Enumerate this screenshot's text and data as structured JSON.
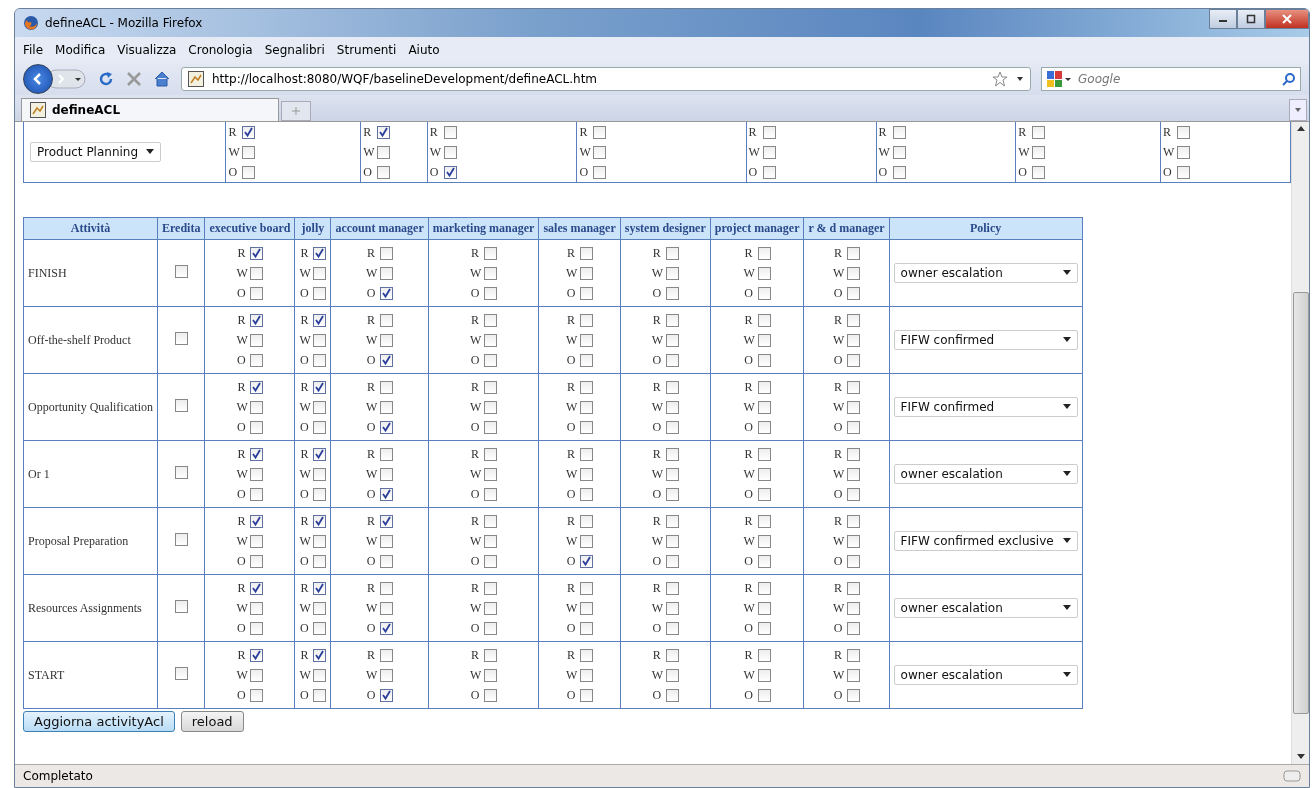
{
  "window": {
    "title": "defineACL - Mozilla Firefox"
  },
  "menu": [
    "File",
    "Modifica",
    "Visualizza",
    "Cronologia",
    "Segnalibri",
    "Strumenti",
    "Aiuto"
  ],
  "address": {
    "value": "http://localhost:8080/WQF/baselineDevelopment/defineACL.htm"
  },
  "search": {
    "placeholder": "Google"
  },
  "tabs": [
    {
      "label": "defineACL",
      "selected": true
    }
  ],
  "top_row": {
    "select": "Product Planning",
    "cells": [
      [
        {
          "letter": "R",
          "checked": true
        },
        {
          "letter": "W",
          "checked": false
        },
        {
          "letter": "O",
          "checked": false
        }
      ],
      [
        {
          "letter": "R",
          "checked": true
        },
        {
          "letter": "W",
          "checked": false
        },
        {
          "letter": "O",
          "checked": false
        }
      ],
      [
        {
          "letter": "R",
          "checked": false
        },
        {
          "letter": "W",
          "checked": false
        },
        {
          "letter": "O",
          "checked": true
        }
      ],
      [
        {
          "letter": "R",
          "checked": false
        },
        {
          "letter": "W",
          "checked": false
        },
        {
          "letter": "O",
          "checked": false
        }
      ],
      [
        {
          "letter": "R",
          "checked": false
        },
        {
          "letter": "W",
          "checked": false
        },
        {
          "letter": "O",
          "checked": false
        }
      ],
      [
        {
          "letter": "R",
          "checked": false
        },
        {
          "letter": "W",
          "checked": false
        },
        {
          "letter": "O",
          "checked": false
        }
      ],
      [
        {
          "letter": "R",
          "checked": false
        },
        {
          "letter": "W",
          "checked": false
        },
        {
          "letter": "O",
          "checked": false
        }
      ],
      [
        {
          "letter": "R",
          "checked": false
        },
        {
          "letter": "W",
          "checked": false
        },
        {
          "letter": "O",
          "checked": false
        }
      ]
    ]
  },
  "table": {
    "columns": [
      "Attività",
      "Eredita",
      "executive board",
      "jolly",
      "account manager",
      "marketing manager",
      "sales manager",
      "system designer",
      "project manager",
      "r & d manager",
      "Policy"
    ],
    "rows": [
      {
        "activity": "FINISH",
        "inherit": false,
        "executive_board": [
          {
            "letter": "R",
            "checked": true
          },
          {
            "letter": "W",
            "checked": false
          },
          {
            "letter": "O",
            "checked": false
          }
        ],
        "jolly": [
          {
            "letter": "R",
            "checked": true
          },
          {
            "letter": "W",
            "checked": false
          },
          {
            "letter": "O",
            "checked": false
          }
        ],
        "account_manager": [
          {
            "letter": "R",
            "checked": false
          },
          {
            "letter": "W",
            "checked": false
          },
          {
            "letter": "O",
            "checked": true
          }
        ],
        "marketing_manager": [
          {
            "letter": "R",
            "checked": false
          },
          {
            "letter": "W",
            "checked": false
          },
          {
            "letter": "O",
            "checked": false
          }
        ],
        "sales_manager": [
          {
            "letter": "R",
            "checked": false
          },
          {
            "letter": "W",
            "checked": false
          },
          {
            "letter": "O",
            "checked": false
          }
        ],
        "system_designer": [
          {
            "letter": "R",
            "checked": false
          },
          {
            "letter": "W",
            "checked": false
          },
          {
            "letter": "O",
            "checked": false
          }
        ],
        "project_manager": [
          {
            "letter": "R",
            "checked": false
          },
          {
            "letter": "W",
            "checked": false
          },
          {
            "letter": "O",
            "checked": false
          }
        ],
        "rd_manager": [
          {
            "letter": "R",
            "checked": false
          },
          {
            "letter": "W",
            "checked": false
          },
          {
            "letter": "O",
            "checked": false
          }
        ],
        "policy": "owner escalation"
      },
      {
        "activity": "Off-the-shelf Product",
        "inherit": false,
        "executive_board": [
          {
            "letter": "R",
            "checked": true
          },
          {
            "letter": "W",
            "checked": false
          },
          {
            "letter": "O",
            "checked": false
          }
        ],
        "jolly": [
          {
            "letter": "R",
            "checked": true
          },
          {
            "letter": "W",
            "checked": false
          },
          {
            "letter": "O",
            "checked": false
          }
        ],
        "account_manager": [
          {
            "letter": "R",
            "checked": false
          },
          {
            "letter": "W",
            "checked": false
          },
          {
            "letter": "O",
            "checked": true
          }
        ],
        "marketing_manager": [
          {
            "letter": "R",
            "checked": false
          },
          {
            "letter": "W",
            "checked": false
          },
          {
            "letter": "O",
            "checked": false
          }
        ],
        "sales_manager": [
          {
            "letter": "R",
            "checked": false
          },
          {
            "letter": "W",
            "checked": false
          },
          {
            "letter": "O",
            "checked": false
          }
        ],
        "system_designer": [
          {
            "letter": "R",
            "checked": false
          },
          {
            "letter": "W",
            "checked": false
          },
          {
            "letter": "O",
            "checked": false
          }
        ],
        "project_manager": [
          {
            "letter": "R",
            "checked": false
          },
          {
            "letter": "W",
            "checked": false
          },
          {
            "letter": "O",
            "checked": false
          }
        ],
        "rd_manager": [
          {
            "letter": "R",
            "checked": false
          },
          {
            "letter": "W",
            "checked": false
          },
          {
            "letter": "O",
            "checked": false
          }
        ],
        "policy": "FIFW confirmed"
      },
      {
        "activity": "Opportunity Qualification",
        "inherit": false,
        "executive_board": [
          {
            "letter": "R",
            "checked": true
          },
          {
            "letter": "W",
            "checked": false
          },
          {
            "letter": "O",
            "checked": false
          }
        ],
        "jolly": [
          {
            "letter": "R",
            "checked": true
          },
          {
            "letter": "W",
            "checked": false
          },
          {
            "letter": "O",
            "checked": false
          }
        ],
        "account_manager": [
          {
            "letter": "R",
            "checked": false
          },
          {
            "letter": "W",
            "checked": false
          },
          {
            "letter": "O",
            "checked": true
          }
        ],
        "marketing_manager": [
          {
            "letter": "R",
            "checked": false
          },
          {
            "letter": "W",
            "checked": false
          },
          {
            "letter": "O",
            "checked": false
          }
        ],
        "sales_manager": [
          {
            "letter": "R",
            "checked": false
          },
          {
            "letter": "W",
            "checked": false
          },
          {
            "letter": "O",
            "checked": false
          }
        ],
        "system_designer": [
          {
            "letter": "R",
            "checked": false
          },
          {
            "letter": "W",
            "checked": false
          },
          {
            "letter": "O",
            "checked": false
          }
        ],
        "project_manager": [
          {
            "letter": "R",
            "checked": false
          },
          {
            "letter": "W",
            "checked": false
          },
          {
            "letter": "O",
            "checked": false
          }
        ],
        "rd_manager": [
          {
            "letter": "R",
            "checked": false
          },
          {
            "letter": "W",
            "checked": false
          },
          {
            "letter": "O",
            "checked": false
          }
        ],
        "policy": "FIFW confirmed"
      },
      {
        "activity": "Or 1",
        "inherit": false,
        "executive_board": [
          {
            "letter": "R",
            "checked": true
          },
          {
            "letter": "W",
            "checked": false
          },
          {
            "letter": "O",
            "checked": false
          }
        ],
        "jolly": [
          {
            "letter": "R",
            "checked": true
          },
          {
            "letter": "W",
            "checked": false
          },
          {
            "letter": "O",
            "checked": false
          }
        ],
        "account_manager": [
          {
            "letter": "R",
            "checked": false
          },
          {
            "letter": "W",
            "checked": false
          },
          {
            "letter": "O",
            "checked": true
          }
        ],
        "marketing_manager": [
          {
            "letter": "R",
            "checked": false
          },
          {
            "letter": "W",
            "checked": false
          },
          {
            "letter": "O",
            "checked": false
          }
        ],
        "sales_manager": [
          {
            "letter": "R",
            "checked": false
          },
          {
            "letter": "W",
            "checked": false
          },
          {
            "letter": "O",
            "checked": false
          }
        ],
        "system_designer": [
          {
            "letter": "R",
            "checked": false
          },
          {
            "letter": "W",
            "checked": false
          },
          {
            "letter": "O",
            "checked": false
          }
        ],
        "project_manager": [
          {
            "letter": "R",
            "checked": false
          },
          {
            "letter": "W",
            "checked": false
          },
          {
            "letter": "O",
            "checked": false
          }
        ],
        "rd_manager": [
          {
            "letter": "R",
            "checked": false
          },
          {
            "letter": "W",
            "checked": false
          },
          {
            "letter": "O",
            "checked": false
          }
        ],
        "policy": "owner escalation"
      },
      {
        "activity": "Proposal Preparation",
        "inherit": false,
        "executive_board": [
          {
            "letter": "R",
            "checked": true
          },
          {
            "letter": "W",
            "checked": false
          },
          {
            "letter": "O",
            "checked": false
          }
        ],
        "jolly": [
          {
            "letter": "R",
            "checked": true
          },
          {
            "letter": "W",
            "checked": false
          },
          {
            "letter": "O",
            "checked": false
          }
        ],
        "account_manager": [
          {
            "letter": "R",
            "checked": true
          },
          {
            "letter": "W",
            "checked": false
          },
          {
            "letter": "O",
            "checked": false
          }
        ],
        "marketing_manager": [
          {
            "letter": "R",
            "checked": false
          },
          {
            "letter": "W",
            "checked": false
          },
          {
            "letter": "O",
            "checked": false
          }
        ],
        "sales_manager": [
          {
            "letter": "R",
            "checked": false
          },
          {
            "letter": "W",
            "checked": false
          },
          {
            "letter": "O",
            "checked": true
          }
        ],
        "system_designer": [
          {
            "letter": "R",
            "checked": false
          },
          {
            "letter": "W",
            "checked": false
          },
          {
            "letter": "O",
            "checked": false
          }
        ],
        "project_manager": [
          {
            "letter": "R",
            "checked": false
          },
          {
            "letter": "W",
            "checked": false
          },
          {
            "letter": "O",
            "checked": false
          }
        ],
        "rd_manager": [
          {
            "letter": "R",
            "checked": false
          },
          {
            "letter": "W",
            "checked": false
          },
          {
            "letter": "O",
            "checked": false
          }
        ],
        "policy": "FIFW confirmed exclusive"
      },
      {
        "activity": "Resources Assignments",
        "inherit": false,
        "executive_board": [
          {
            "letter": "R",
            "checked": true
          },
          {
            "letter": "W",
            "checked": false
          },
          {
            "letter": "O",
            "checked": false
          }
        ],
        "jolly": [
          {
            "letter": "R",
            "checked": true
          },
          {
            "letter": "W",
            "checked": false
          },
          {
            "letter": "O",
            "checked": false
          }
        ],
        "account_manager": [
          {
            "letter": "R",
            "checked": false
          },
          {
            "letter": "W",
            "checked": false
          },
          {
            "letter": "O",
            "checked": true
          }
        ],
        "marketing_manager": [
          {
            "letter": "R",
            "checked": false
          },
          {
            "letter": "W",
            "checked": false
          },
          {
            "letter": "O",
            "checked": false
          }
        ],
        "sales_manager": [
          {
            "letter": "R",
            "checked": false
          },
          {
            "letter": "W",
            "checked": false
          },
          {
            "letter": "O",
            "checked": false
          }
        ],
        "system_designer": [
          {
            "letter": "R",
            "checked": false
          },
          {
            "letter": "W",
            "checked": false
          },
          {
            "letter": "O",
            "checked": false
          }
        ],
        "project_manager": [
          {
            "letter": "R",
            "checked": false
          },
          {
            "letter": "W",
            "checked": false
          },
          {
            "letter": "O",
            "checked": false
          }
        ],
        "rd_manager": [
          {
            "letter": "R",
            "checked": false
          },
          {
            "letter": "W",
            "checked": false
          },
          {
            "letter": "O",
            "checked": false
          }
        ],
        "policy": "owner escalation"
      },
      {
        "activity": "START",
        "inherit": false,
        "executive_board": [
          {
            "letter": "R",
            "checked": true
          },
          {
            "letter": "W",
            "checked": false
          },
          {
            "letter": "O",
            "checked": false
          }
        ],
        "jolly": [
          {
            "letter": "R",
            "checked": true
          },
          {
            "letter": "W",
            "checked": false
          },
          {
            "letter": "O",
            "checked": false
          }
        ],
        "account_manager": [
          {
            "letter": "R",
            "checked": false
          },
          {
            "letter": "W",
            "checked": false
          },
          {
            "letter": "O",
            "checked": true
          }
        ],
        "marketing_manager": [
          {
            "letter": "R",
            "checked": false
          },
          {
            "letter": "W",
            "checked": false
          },
          {
            "letter": "O",
            "checked": false
          }
        ],
        "sales_manager": [
          {
            "letter": "R",
            "checked": false
          },
          {
            "letter": "W",
            "checked": false
          },
          {
            "letter": "O",
            "checked": false
          }
        ],
        "system_designer": [
          {
            "letter": "R",
            "checked": false
          },
          {
            "letter": "W",
            "checked": false
          },
          {
            "letter": "O",
            "checked": false
          }
        ],
        "project_manager": [
          {
            "letter": "R",
            "checked": false
          },
          {
            "letter": "W",
            "checked": false
          },
          {
            "letter": "O",
            "checked": false
          }
        ],
        "rd_manager": [
          {
            "letter": "R",
            "checked": false
          },
          {
            "letter": "W",
            "checked": false
          },
          {
            "letter": "O",
            "checked": false
          }
        ],
        "policy": "owner escalation"
      }
    ]
  },
  "buttons": [
    {
      "label": "Aggiorna activityAcl",
      "kind": "primary"
    },
    {
      "label": "reload",
      "kind": "plain"
    }
  ],
  "status_bar": "Completato"
}
